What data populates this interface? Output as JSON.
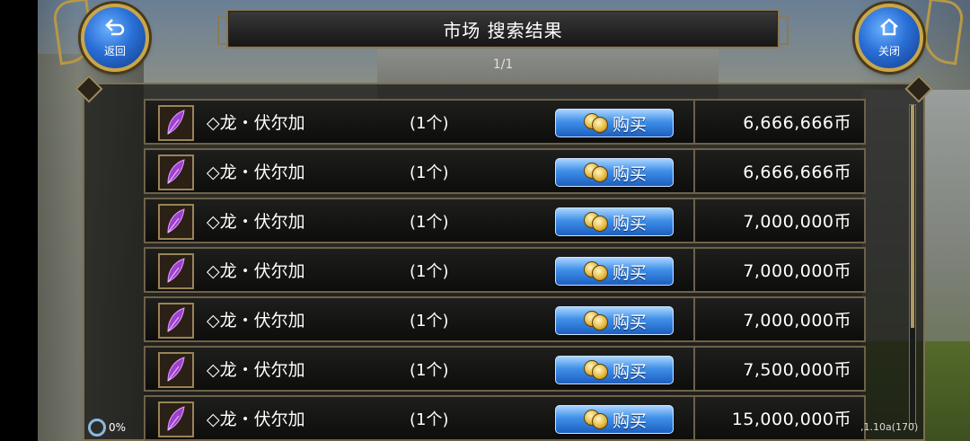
{
  "header": {
    "title": "市场  搜索结果",
    "page_indicator": "1/1",
    "back_label": "返回",
    "close_label": "关闭"
  },
  "listings": [
    {
      "name": "◇龙・伏尔加",
      "quantity": "(1个)",
      "buy_label": "购买",
      "price": "6,666,666币"
    },
    {
      "name": "◇龙・伏尔加",
      "quantity": "(1个)",
      "buy_label": "购买",
      "price": "6,666,666币"
    },
    {
      "name": "◇龙・伏尔加",
      "quantity": "(1个)",
      "buy_label": "购买",
      "price": "7,000,000币"
    },
    {
      "name": "◇龙・伏尔加",
      "quantity": "(1个)",
      "buy_label": "购买",
      "price": "7,000,000币"
    },
    {
      "name": "◇龙・伏尔加",
      "quantity": "(1个)",
      "buy_label": "购买",
      "price": "7,000,000币"
    },
    {
      "name": "◇龙・伏尔加",
      "quantity": "(1个)",
      "buy_label": "购买",
      "price": "7,500,000币"
    },
    {
      "name": "◇龙・伏尔加",
      "quantity": "(1个)",
      "buy_label": "购买",
      "price": "15,000,000币"
    }
  ],
  "status": {
    "progress_text": "0%",
    "version_text": ",1.10a(170)"
  },
  "scroll": {
    "position": 0
  },
  "icons": {
    "item": "purple-feather-icon",
    "buy": "coin-icon",
    "back": "back-arrow-icon",
    "close": "home-icon"
  },
  "colors": {
    "buy_button": "#3f8fe8",
    "panel_border": "#7d6f52",
    "item_icon": "#a040d0"
  }
}
